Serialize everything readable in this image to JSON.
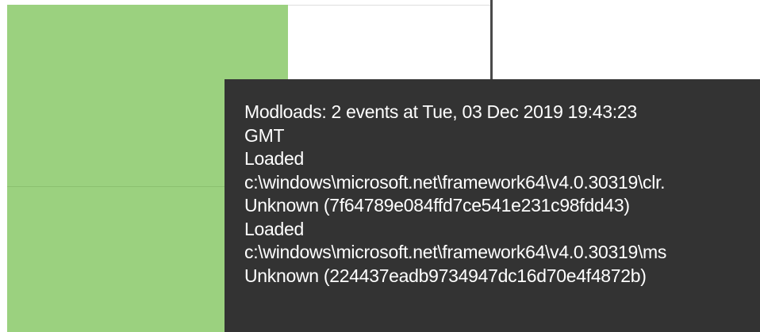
{
  "chart": {
    "bar_color": "#9bd17f",
    "axis_color": "#4a4a4a"
  },
  "tooltip": {
    "background": "#333333",
    "text_color": "#ffffff",
    "lines": [
      "Modloads: 2 events at Tue, 03 Dec 2019 19:43:23",
      "GMT",
      "Loaded",
      "c:\\windows\\microsoft.net\\framework64\\v4.0.30319\\clr.",
      "Unknown (7f64789e084ffd7ce541e231c98fdd43)",
      "Loaded",
      "c:\\windows\\microsoft.net\\framework64\\v4.0.30319\\ms",
      "Unknown (224437eadb9734947dc16d70e4f4872b)"
    ]
  }
}
